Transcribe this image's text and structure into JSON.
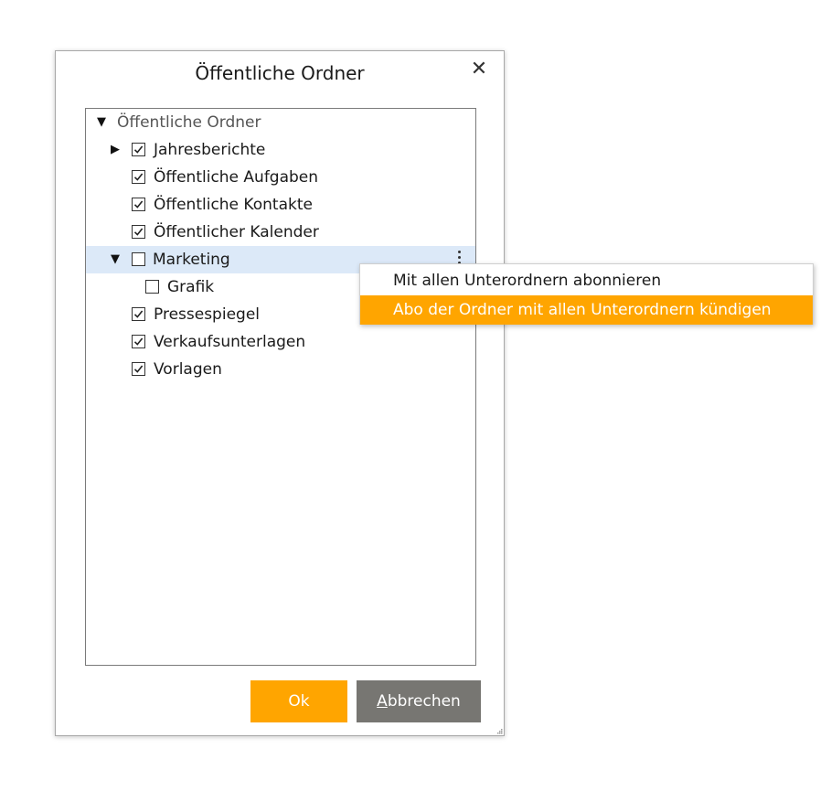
{
  "dialog": {
    "title": "Öffentliche Ordner",
    "close_icon": "close-icon"
  },
  "tree": {
    "root": {
      "label": "Öffentliche Ordner",
      "expanded": true
    },
    "items": [
      {
        "label": "Jahresberichte",
        "checked": true,
        "expandable": true,
        "expanded": false,
        "level": 1
      },
      {
        "label": "Öffentliche Aufgaben",
        "checked": true,
        "expandable": false,
        "level": 1
      },
      {
        "label": "Öffentliche Kontakte",
        "checked": true,
        "expandable": false,
        "level": 1
      },
      {
        "label": "Öffentlicher Kalender",
        "checked": true,
        "expandable": false,
        "level": 1
      },
      {
        "label": "Marketing",
        "checked": false,
        "expandable": true,
        "expanded": true,
        "selected": true,
        "level": 1
      },
      {
        "label": "Grafik",
        "checked": false,
        "expandable": false,
        "level": 2
      },
      {
        "label": "Pressespiegel",
        "checked": true,
        "expandable": false,
        "level": 1
      },
      {
        "label": "Verkaufsunterlagen",
        "checked": true,
        "expandable": false,
        "level": 1
      },
      {
        "label": "Vorlagen",
        "checked": true,
        "expandable": false,
        "level": 1
      }
    ]
  },
  "context_menu": {
    "items": [
      {
        "label": "Mit allen Unterordnern abonnieren",
        "highlighted": false
      },
      {
        "label": "Abo der Ordner mit allen Unterordnern kündigen",
        "highlighted": true
      }
    ]
  },
  "buttons": {
    "ok_label": "Ok",
    "cancel_accesskey": "A",
    "cancel_rest": "bbrechen"
  },
  "colors": {
    "accent": "#ffa500",
    "cancel_button": "#777672",
    "selection": "#dce9f8"
  }
}
